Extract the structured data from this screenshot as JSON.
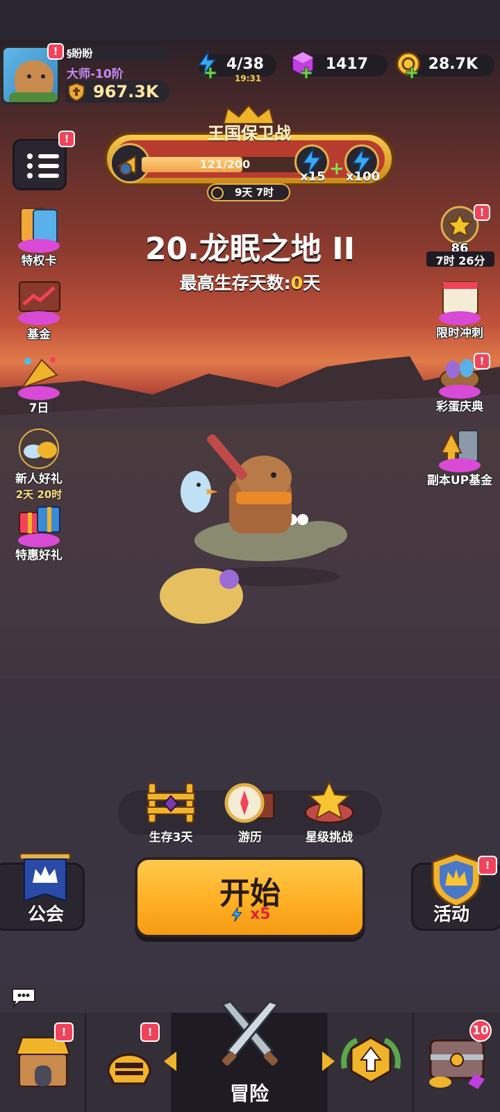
{
  "player": {
    "name": "§盼盼",
    "rank": "大师-10阶",
    "power": "967.3K"
  },
  "resources": {
    "energy": "4/38",
    "energy_timer": "19:31",
    "gems": "1417",
    "gold": "28.7K"
  },
  "event": {
    "title": "王国保卫战",
    "progress": "121/200",
    "progress_value": 121,
    "progress_max": 200,
    "reward_a": "x15",
    "reward_b": "x100",
    "plus": "+",
    "timer": "9天 7时"
  },
  "level": {
    "name": "20.龙眠之地 II",
    "survival_label": "最高生存天数:",
    "survival_value": "0",
    "survival_unit": "天"
  },
  "left_items": [
    {
      "label": "特权卡"
    },
    {
      "label": "基金"
    },
    {
      "label": "7日"
    },
    {
      "label": "新人好礼",
      "sub": "2天 20时"
    },
    {
      "label": "特惠好礼"
    }
  ],
  "right_items": [
    {
      "count": "86",
      "timer": "7时 26分"
    },
    {
      "label": "限时冲刺"
    },
    {
      "label": "彩蛋庆典"
    },
    {
      "label": "副本UP基金"
    }
  ],
  "modes": [
    {
      "label": "生存3天"
    },
    {
      "label": "游历"
    },
    {
      "label": "星级挑战"
    }
  ],
  "start": {
    "label": "开始",
    "cost": "x5"
  },
  "guild": {
    "label": "公会"
  },
  "activity": {
    "label": "活动"
  },
  "nav": {
    "adventure_label": "冒险",
    "chest_count": "10"
  },
  "badge_text": "!",
  "colors": {
    "accent": "#ffb024",
    "alert": "#f2425a",
    "rank": "#c18bf5",
    "highlight": "#ffd43b"
  }
}
